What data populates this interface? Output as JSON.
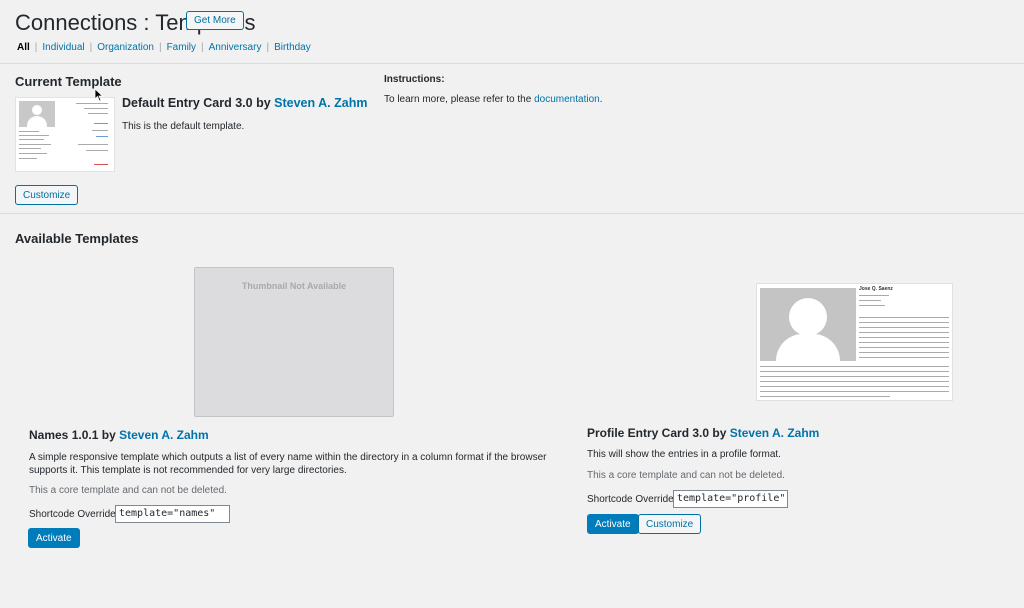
{
  "header": {
    "title": "Connections : Templates",
    "get_more_label": "Get More"
  },
  "filters": [
    "All",
    "Individual",
    "Organization",
    "Family",
    "Anniversary",
    "Birthday"
  ],
  "current": {
    "heading": "Current Template",
    "template_name": "Default Entry Card 3.0",
    "by": "by",
    "author": "Steven A. Zahm",
    "description": "This is the default template.",
    "customize_label": "Customize"
  },
  "instructions": {
    "heading": "Instructions:",
    "text": "To learn more, please refer to the",
    "link": "documentation",
    "suffix": "."
  },
  "available": {
    "heading": "Available Templates",
    "templates": [
      {
        "thumbnail_text": "Thumbnail Not Available",
        "name": "Names 1.0.1",
        "by": "by",
        "author": "Steven A. Zahm",
        "description": "A simple responsive template which outputs a list of every name within the directory in a column format if the browser supports it. This template is not recommended for very large directories.",
        "core_note": "This a core template and can not be deleted.",
        "shortcode_label": "Shortcode Override:",
        "shortcode_value": "template=\"names\"",
        "activate_label": "Activate"
      },
      {
        "name": "Profile Entry Card 3.0",
        "by": "by",
        "author": "Steven A. Zahm",
        "description": "This will show the entries in a profile format.",
        "core_note": "This a core template and can not be deleted.",
        "shortcode_label": "Shortcode Override:",
        "shortcode_value": "template=\"profile\"",
        "activate_label": "Activate",
        "customize_label": "Customize",
        "preview_name": "Jose Q. Saenz"
      }
    ]
  }
}
